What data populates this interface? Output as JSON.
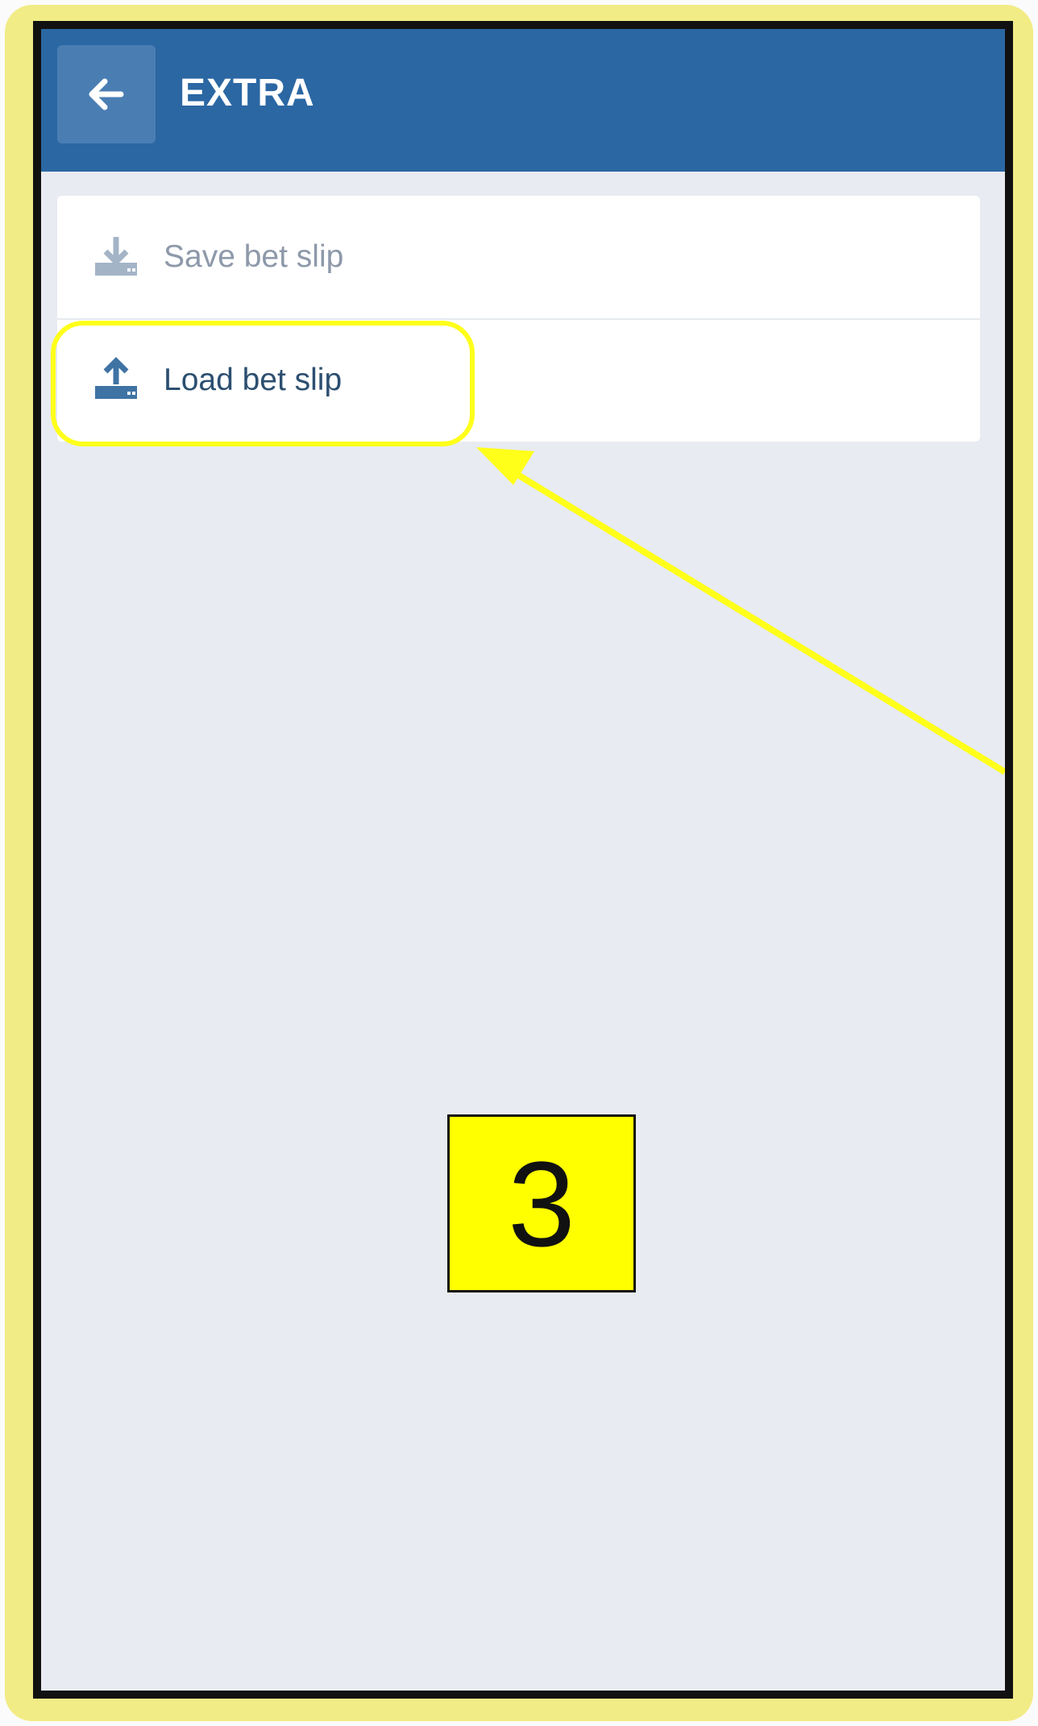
{
  "header": {
    "title": "EXTRA",
    "back_icon": "arrow-left-icon"
  },
  "menu": {
    "items": [
      {
        "label": "Save bet slip",
        "icon": "download-icon",
        "state": "disabled"
      },
      {
        "label": "Load bet slip",
        "icon": "upload-icon",
        "state": "enabled"
      }
    ]
  },
  "annotation": {
    "step_number": "3"
  },
  "colors": {
    "header_bg": "#2b67a3",
    "page_bg": "#e8ebf1",
    "annotation_yellow": "#ffff00",
    "disabled_text": "#8d99aa",
    "active_text": "#2c4f70",
    "icon_color": "#3f73a4"
  }
}
